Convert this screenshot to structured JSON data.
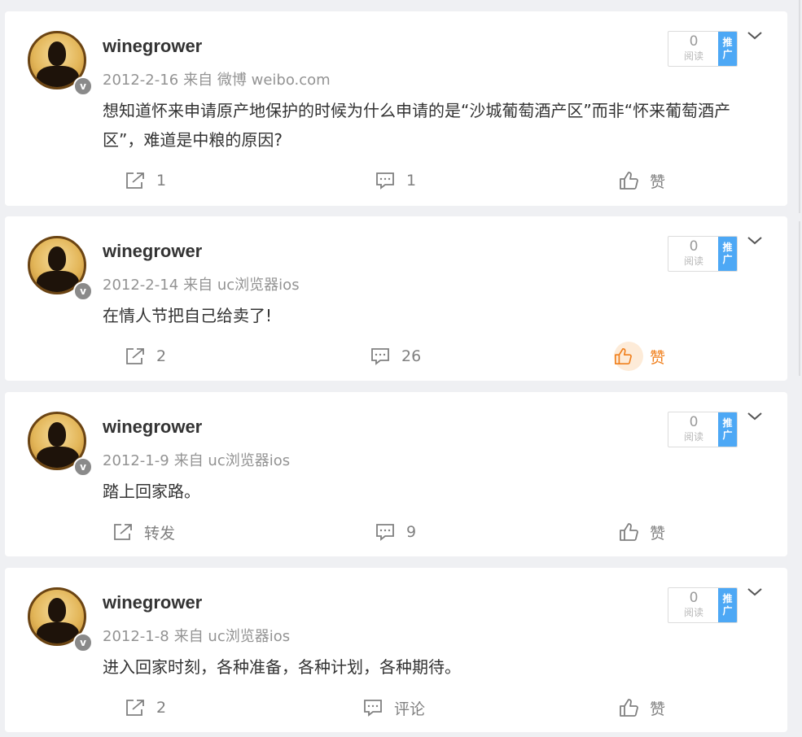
{
  "posts": [
    {
      "username": "winegrower",
      "date": "2012-2-16",
      "source": "来自 微博 weibo.com",
      "text": "想知道怀来申请原产地保护的时候为什么申请的是“沙城葡萄酒产区”而非“怀来葡萄酒产区”，难道是中粮的原因?",
      "read_count": "0",
      "read_label": "阅读",
      "promo_label": "推广",
      "repost": "1",
      "comment": "1",
      "like": "赞",
      "liked": false
    },
    {
      "username": "winegrower",
      "date": "2012-2-14",
      "source": "来自 uc浏览器ios",
      "text": "在情人节把自己给卖了!",
      "read_count": "0",
      "read_label": "阅读",
      "promo_label": "推广",
      "repost": "2",
      "comment": "26",
      "like": "赞",
      "liked": true
    },
    {
      "username": "winegrower",
      "date": "2012-1-9",
      "source": "来自 uc浏览器ios",
      "text": "踏上回家路。",
      "read_count": "0",
      "read_label": "阅读",
      "promo_label": "推广",
      "repost": "转发",
      "comment": "9",
      "like": "赞",
      "liked": false
    },
    {
      "username": "winegrower",
      "date": "2012-1-8",
      "source": "来自 uc浏览器ios",
      "text": "进入回家时刻，各种准备，各种计划，各种期待。",
      "read_count": "0",
      "read_label": "阅读",
      "promo_label": "推广",
      "repost": "2",
      "comment": "评论",
      "like": "赞",
      "liked": false
    }
  ],
  "icons": {
    "repost": "share-icon",
    "comment": "comment-icon",
    "like": "thumbs-up-icon",
    "more": "chevron-down-icon"
  },
  "colors": {
    "liked": "#f07f1c",
    "promo": "#4da8f5",
    "username": "#333333",
    "meta": "#939393"
  }
}
